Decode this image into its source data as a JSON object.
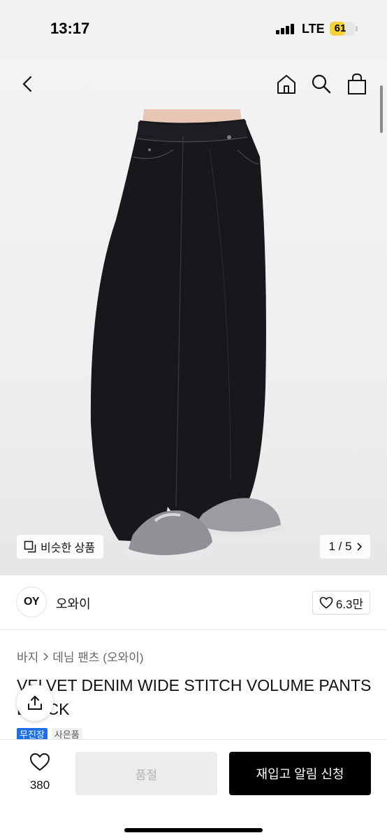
{
  "status_bar": {
    "time": "13:17",
    "network": "LTE",
    "battery": "61",
    "battery_level": 0.61
  },
  "nav": {
    "back_icon": "chevron-left-icon",
    "home_icon": "home-icon",
    "search_icon": "search-icon",
    "cart_icon": "shopping-bag-icon"
  },
  "gallery": {
    "similar_label": "비슷한 상품",
    "page": "1 / 5"
  },
  "brand": {
    "logo_text": "OY",
    "name": "오와이",
    "likes": "6.3만"
  },
  "breadcrumb": {
    "category": "바지",
    "sub_category": "데님 팬츠 (오와이)"
  },
  "product": {
    "title": "VELVET DENIM WIDE STITCH VOLUME PANTS BLACK"
  },
  "tags": [
    "무진장",
    "사은품"
  ],
  "bottom_bar": {
    "wish_count": "380",
    "soldout_label": "품절",
    "restock_label": "재입고 알림 신청"
  },
  "colors": {
    "accent_blue": "#1e6ee6",
    "battery_yellow": "#f5d23b",
    "primary_button": "#000000"
  }
}
